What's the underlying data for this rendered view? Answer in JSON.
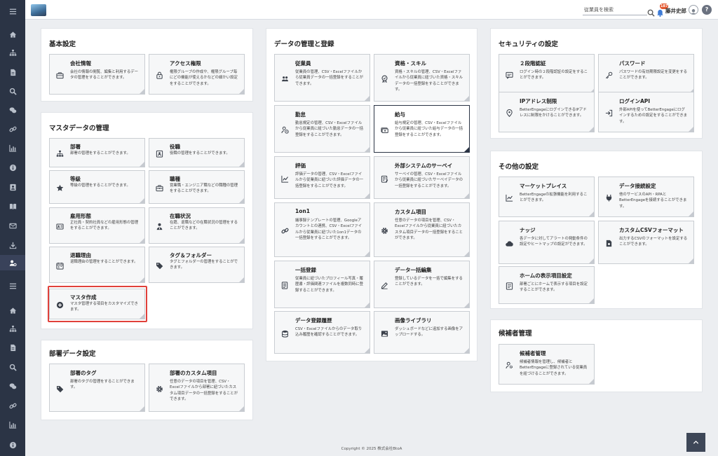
{
  "topbar": {
    "search_placeholder": "従業員を検索",
    "notification_count": "187",
    "username": "藤井史郎",
    "help_label": "?"
  },
  "colors": {
    "sidebar": "#2b3445",
    "accent_highlight": "#e0403a",
    "badge": "#e4572e"
  },
  "sidebar": {
    "icons": [
      "menu-icon",
      "home-icon",
      "org-chart-icon",
      "document-icon",
      "search-icon",
      "chat-icon",
      "link-icon",
      "bar-chart-icon",
      "info-icon",
      "profile-card-icon",
      "book-icon",
      "mail-icon",
      "download-icon",
      "users-settings-icon",
      "menu-icon",
      "home-icon",
      "org-chart-icon",
      "document-icon",
      "search-icon",
      "chat-icon",
      "link-icon",
      "bar-chart-icon",
      "info-icon"
    ],
    "active_icon": "users-settings-icon"
  },
  "sections": {
    "basic": {
      "title": "基本設定",
      "items": [
        {
          "title": "会社情報",
          "desc": "会社の情報の閲覧、編集と利用するデータの管理をすることができます。",
          "icon": "briefcase-icon"
        },
        {
          "title": "アクセス権限",
          "desc": "権限グループの作成や、権限グループ毎にどの機能が使えるかなどの細かい設定をすることができます。",
          "icon": "lock-icon"
        }
      ]
    },
    "master": {
      "title": "マスタデータの管理",
      "items": [
        {
          "title": "部署",
          "desc": "部署の管理をすることができます。",
          "icon": "org-chart-icon"
        },
        {
          "title": "役職",
          "desc": "役職の管理をすることができます。",
          "icon": "badge-icon"
        },
        {
          "title": "等級",
          "desc": "等級の管理をすることができます。",
          "icon": "star-icon"
        },
        {
          "title": "職種",
          "desc": "営業職・エンジニア職などの職種の管理をすることができます。",
          "icon": "toolbox-icon"
        },
        {
          "title": "雇用形態",
          "desc": "正社員・契約社員などの雇用形態の管理をすることができます。",
          "icon": "id-card-icon"
        },
        {
          "title": "在職状況",
          "desc": "在籍、退職などの在職状況の管理をすることができます。",
          "icon": "person-tie-icon"
        },
        {
          "title": "退職理由",
          "desc": "退職理由の管理をすることができます。",
          "icon": "calendar-icon"
        },
        {
          "title": "タグ＆フォルダー",
          "desc": "タグとフォルダーの管理をすることができます。",
          "icon": "tag-icon"
        },
        {
          "title": "マスタ作成",
          "desc": "マスタ管理する項目をカスタマイズできます。",
          "icon": "plus-circle-icon"
        }
      ]
    },
    "dept": {
      "title": "部署データ設定",
      "items": [
        {
          "title": "部署のタグ",
          "desc": "部署のタグの管理をすることができます。",
          "icon": "tag-icon"
        },
        {
          "title": "部署のカスタム項目",
          "desc": "任意のデータの項目を管理、CSV・Excelファイルから部署に紐づいたカスタム項目データの一括登録をすることができます。",
          "icon": "gear-icon"
        }
      ]
    },
    "data": {
      "title": "データの管理と登録",
      "items": [
        {
          "title": "従業員",
          "desc": "従業員の管理、CSV・Excelファイルから従業員データの一括登録をすることができます。",
          "icon": "people-icon"
        },
        {
          "title": "資格・スキル",
          "desc": "資格・スキルの管理、CSV・Excelファイルから従業員に紐づいた資格・スキルデータの一括登録をすることができます。",
          "icon": "cert-icon"
        },
        {
          "title": "勤怠",
          "desc": "勤怠規定の管理、CSV・Excelファイルから従業員に紐づいた勤怠データの一括登録をすることができます。",
          "icon": "person-clock-icon"
        },
        {
          "title": "給与",
          "desc": "給与規定の管理、CSV・Excelファイルから従業員に紐づいた給与データの一括登録をすることができます。",
          "icon": "money-icon"
        },
        {
          "title": "評価",
          "desc": "評価データの管理、CSV・Excelファイルから従業員に紐づいた評価データの一括登録をすることができます。",
          "icon": "chart-icon"
        },
        {
          "title": "外部システムのサーベイ",
          "desc": "サーベイの管理、CSV・Excelファイルから従業員に紐づいたサーベイデータの一括登録をすることができます。",
          "icon": "survey-icon"
        },
        {
          "title": "1on1",
          "desc": "議事録テンプレートの管理、Googleアカウントとの連携、CSV・Excelファイルから従業員に紐づいた1on1データの一括登録をすることができます。",
          "icon": "link-icon"
        },
        {
          "title": "カスタム項目",
          "desc": "任意のデータの項目を管理、CSV・Excelファイルから従業員に紐づいたカスタム項目データの一括登録をすることができます。",
          "icon": "gear-icon"
        },
        {
          "title": "一括登録",
          "desc": "従業員に紐づいたプロフィール写真・履歴書・評価関連ファイルを複数同時に登録することができます。",
          "icon": "bulk-icon"
        },
        {
          "title": "データ一括編集",
          "desc": "登録しているデータを一括で編集をすることができます。",
          "icon": "edit-icon"
        },
        {
          "title": "データ登録履歴",
          "desc": "CSV・Excelファイルからのデータ取り込み履歴を確認することができます。",
          "icon": "database-icon"
        },
        {
          "title": "画像ライブラリ",
          "desc": "ダッシュボードなどに追加する画像をアップロードする。",
          "icon": "image-icon"
        }
      ]
    },
    "security": {
      "title": "セキュリティの設定",
      "items": [
        {
          "title": "２段階認証",
          "desc": "ログイン時の２段階認証の設定をすることができます。",
          "icon": "message-icon"
        },
        {
          "title": "パスワード",
          "desc": "パスワードの有効期限設定を変更をすることができます。",
          "icon": "key-icon"
        },
        {
          "title": "IPアドレス制限",
          "desc": "BetterEngageにログインできるIPアドレスに制限をかけることができます。",
          "icon": "location-icon"
        },
        {
          "title": "ログインAPI",
          "desc": "外部APIを使ってBetterEngageにログインするための設定をすることができます。",
          "icon": "login-icon"
        }
      ]
    },
    "other": {
      "title": "その他の設定",
      "items": [
        {
          "title": "マーケットプレイス",
          "desc": "BetterEngageの拡張機能を利用することができます。",
          "icon": "trend-icon"
        },
        {
          "title": "データ接続設定",
          "desc": "他のサービスのAPI・RPAとBetterEngageを接続することができます。",
          "icon": "plug-icon"
        },
        {
          "title": "ナッジ",
          "desc": "各データに対してアラートの発動条件の設定やヒートマップの設定ができます。",
          "icon": "cloud-icon"
        },
        {
          "title": "カスタムCSVフォーマット",
          "desc": "出力するCSVのフォーマットを設定することができます。",
          "icon": "csv-gear-icon"
        },
        {
          "title": "ホームの表示項目設定",
          "desc": "部署ごとにホームで表示する項目を設定することができます。",
          "icon": "home-list-icon"
        }
      ]
    },
    "candidate": {
      "title": "候補者管理",
      "items": [
        {
          "title": "候補者管理",
          "desc": "候補者情報を管理し、候補者とBetterEngageに登録されている従業員を紐づけることができます。",
          "icon": "person-gear-icon"
        }
      ]
    }
  },
  "footer": {
    "copyright": "Copyright © 2025 株式会社BtoA"
  }
}
